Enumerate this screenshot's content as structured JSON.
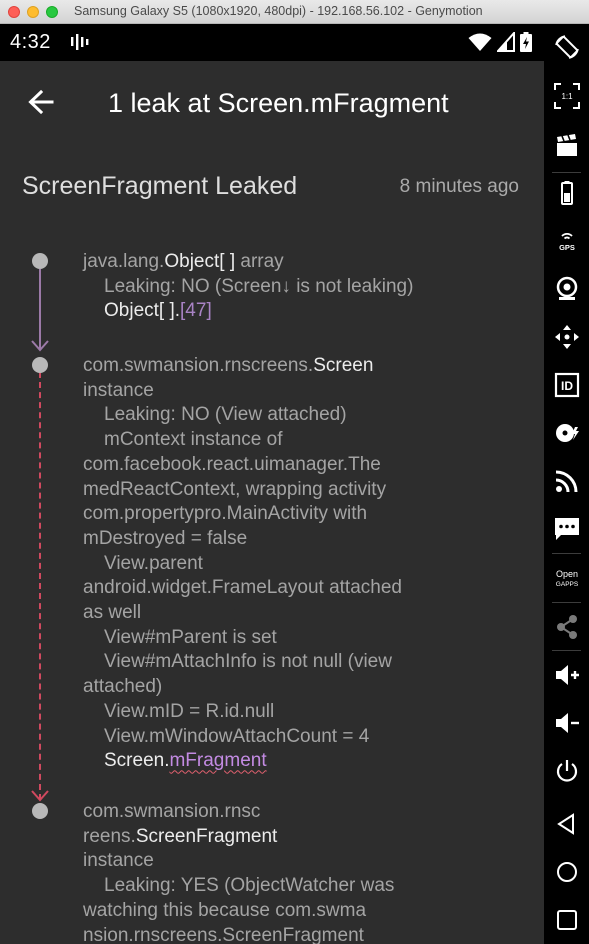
{
  "window": {
    "title": "Samsung Galaxy S5 (1080x1920, 480dpi) - 192.168.56.102 - Genymotion"
  },
  "statusbar": {
    "time": "4:32"
  },
  "appbar": {
    "title": "1 leak at Screen.mFragment"
  },
  "header": {
    "title": "ScreenFragment Leaked",
    "time_ago": "8 minutes ago"
  },
  "trace": {
    "node1": {
      "a": "java.lang.",
      "b": "Object[ ]",
      "c": " array",
      "leaking": "Leaking: NO (Screen↓ is not leaking)",
      "ref_name": "Object[ ].",
      "ref_index": "[47]"
    },
    "node2": {
      "a": "com.swmansion.rnscreens.",
      "b": "Screen",
      "l2": "instance",
      "l3": "Leaking: NO (View attached)",
      "l4": "mContext instance of",
      "l5": "com.facebook.react.uimanager.The",
      "l6": "medReactContext, wrapping activity",
      "l7": "com.propertypro.MainActivity with",
      "l8": "mDestroyed = false",
      "l9": "View.parent",
      "l10": "android.widget.FrameLayout attached",
      "l11": "as well",
      "l12": "View#mParent is set",
      "l13": "View#mAttachInfo is not null (view",
      "l14": "attached)",
      "l15": "View.mID = R.id.null",
      "l16": "View.mWindowAttachCount = 4",
      "ref_name": "Screen.",
      "ref_field": "mFragment"
    },
    "node3": {
      "l1": "com.swmansion.rnsc",
      "l2a": "reens.",
      "l2b": "ScreenFragment",
      "l3": "instance",
      "l4": "Leaking: YES (ObjectWatcher was",
      "l5": "watching this because com.swma",
      "l6": "nsion.rnscreens.ScreenFragment"
    }
  },
  "sidebar": {
    "items": [
      "rotate-icon",
      "pixel-perfect-icon",
      "capture-icon",
      "battery-icon",
      "gps-icon",
      "webcam-icon",
      "move-icon",
      "device-id-icon",
      "disk-io-icon",
      "cast-icon",
      "sms-icon",
      "open-gapps-icon",
      "share-icon",
      "volume-up-icon",
      "volume-down-icon",
      "power-icon",
      "back-icon",
      "home-icon",
      "recents-icon"
    ],
    "gps_label": "GPS",
    "id_label": "ID",
    "pixel_label": "1:1",
    "gapps_label_1": "Open",
    "gapps_label_2": "GAPPS"
  },
  "colors": {
    "accent": "#a983c5",
    "dashed_line": "#d0495f",
    "solid_line": "#9c7aa8"
  }
}
